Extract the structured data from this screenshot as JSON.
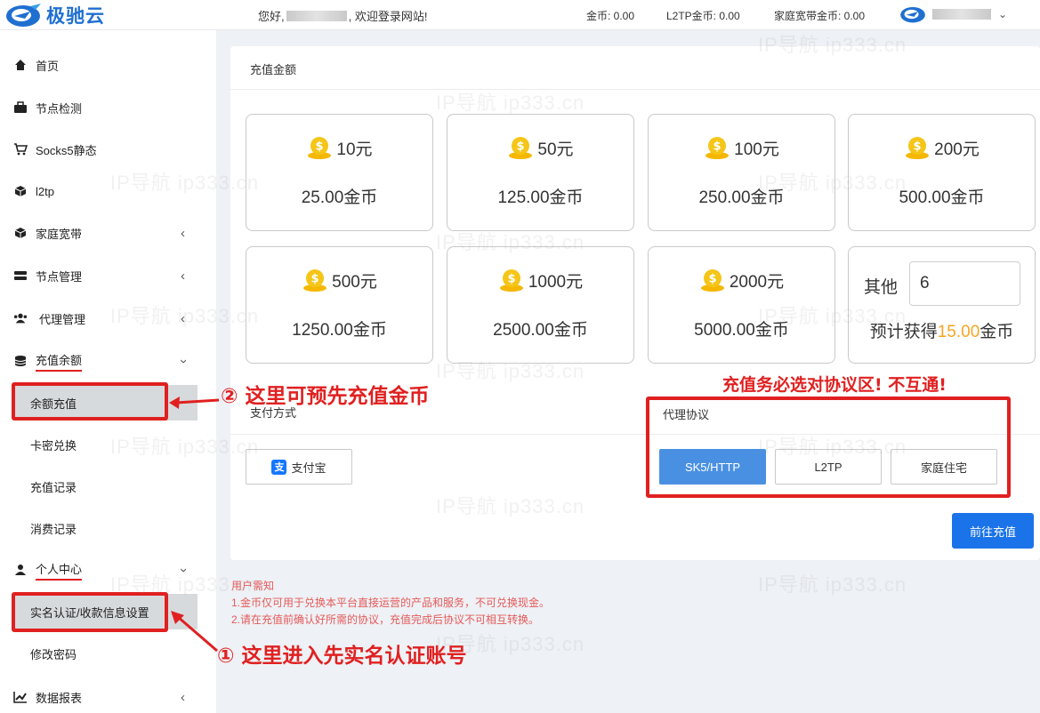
{
  "header": {
    "brand": "极驰云",
    "greeting_prefix": "您好,",
    "greeting_suffix": ", 欢迎登录网站!",
    "coins": "金币: 0.00",
    "l2tp_coins": "L2TP金币: 0.00",
    "home_coins": "家庭宽带金币: 0.00"
  },
  "sidebar": {
    "items": [
      {
        "label": "首页",
        "icon": "home-icon"
      },
      {
        "label": "节点检测",
        "icon": "briefcase-icon"
      },
      {
        "label": "Socks5静态",
        "icon": "cart-icon"
      },
      {
        "label": "l2tp",
        "icon": "cube-icon"
      },
      {
        "label": "家庭宽带",
        "icon": "cube-icon"
      },
      {
        "label": "节点管理",
        "icon": "server-icon"
      },
      {
        "label": "代理管理",
        "icon": "users-icon"
      },
      {
        "label": "充值余额",
        "icon": "coins-icon"
      },
      {
        "label": "个人中心",
        "icon": "user-icon"
      },
      {
        "label": "数据报表",
        "icon": "chart-icon"
      }
    ],
    "recharge_sub": [
      "余额充值",
      "卡密兑换",
      "充值记录",
      "消费记录"
    ],
    "personal_sub": [
      "实名认证/收款信息设置",
      "修改密码"
    ]
  },
  "main": {
    "title": "充值金额",
    "tiles": [
      {
        "amount": "10元",
        "coins": "25.00金币"
      },
      {
        "amount": "50元",
        "coins": "125.00金币"
      },
      {
        "amount": "100元",
        "coins": "250.00金币"
      },
      {
        "amount": "200元",
        "coins": "500.00金币"
      },
      {
        "amount": "500元",
        "coins": "1250.00金币"
      },
      {
        "amount": "1000元",
        "coins": "2500.00金币"
      },
      {
        "amount": "2000元",
        "coins": "5000.00金币"
      }
    ],
    "other": {
      "label": "其他",
      "value": "6",
      "est_prefix": "预计获得",
      "est_value": "15.00",
      "est_suffix": "金币"
    },
    "payment_title": "支付方式",
    "alipay_label": "支付宝",
    "protocol_title": "代理协议",
    "protocols": [
      "SK5/HTTP",
      "L2TP",
      "家庭住宅"
    ],
    "submit_label": "前往充值"
  },
  "notice": {
    "title": "用户需知",
    "line1": "1.金币仅可用于兑换本平台直接运营的产品和服务，不可兑换现金。",
    "line2": "2.请在充值前确认好所需的协议，充值完成后协议不可相互转换。"
  },
  "annotations": {
    "a1": "① 这里进入先实名认证账号",
    "a2": "② 这里可预先充值金币",
    "a3": "充值务必选对协议区! 不互通!"
  },
  "watermark": "IP导航  ip333.cn",
  "colors": {
    "brand": "#1f6fd1",
    "accent": "#1a73e8",
    "annotation": "#e02020",
    "highlight": "#f5a623"
  }
}
